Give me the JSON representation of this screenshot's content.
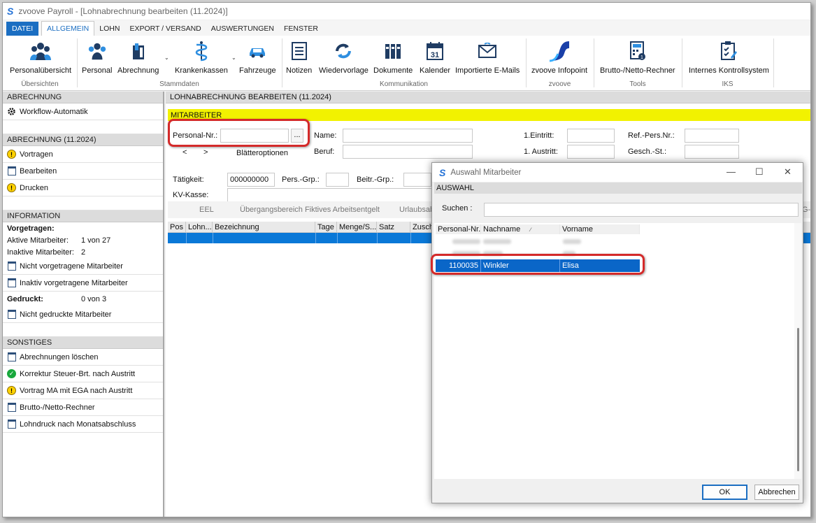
{
  "window": {
    "title": "zvoove Payroll - [Lohnabrechnung bearbeiten (11.2024)]"
  },
  "menu": {
    "datei": "DATEI",
    "tabs": [
      "ALLGEMEIN",
      "LOHN",
      "EXPORT / VERSAND",
      "AUSWERTUNGEN",
      "FENSTER"
    ]
  },
  "ribbon": {
    "buttons": [
      "Personalübersicht",
      "Personal",
      "Abrechnung",
      "Krankenkassen",
      "Fahrzeuge",
      "Notizen",
      "Wiedervorlage",
      "Dokumente",
      "Kalender",
      "Importierte E-Mails",
      "zvoove Infopoint",
      "Brutto-/Netto-Rechner",
      "Internes Kontrollsystem"
    ],
    "groups": [
      "Übersichten",
      "Stammdaten",
      "Kommunikation",
      "zvoove",
      "Tools",
      "IKS"
    ],
    "calendar_day": "31"
  },
  "sidebar": {
    "abrechnung_header": "ABRECHNUNG",
    "workflow": "Workflow-Automatik",
    "abrechnung_month_header": "ABRECHNUNG (11.2024)",
    "vortragen": "Vortragen",
    "bearbeiten": "Bearbeiten",
    "drucken": "Drucken",
    "information_header": "INFORMATION",
    "vorgetragen_label": "Vorgetragen:",
    "aktive_label": "Aktive Mitarbeiter:",
    "aktive_value": "1 von 27",
    "inaktive_label": "Inaktive Mitarbeiter:",
    "inaktive_value": "2",
    "nicht_vorgetragene": "Nicht vorgetragene Mitarbeiter",
    "inaktiv_vorgetragene": "Inaktiv vorgetragene Mitarbeiter",
    "gedruckt_label": "Gedruckt:",
    "gedruckt_value": "0 von 3",
    "nicht_gedruckte": "Nicht gedruckte Mitarbeiter",
    "sonstiges_header": "SONSTIGES",
    "sonstiges": [
      "Abrechnungen löschen",
      "Korrektur Steuer-Brt. nach Austritt",
      "Vortrag MA mit EGA nach Austritt",
      "Brutto-/Netto-Rechner",
      "Lohndruck nach Monatsabschluss"
    ]
  },
  "main": {
    "header": "LOHNABRECHNUNG BEARBEITEN (11.2024)",
    "section": "MITARBEITER",
    "personal_nr_label": "Personal-Nr.:",
    "browse_button": "...",
    "name_label": "Name:",
    "beruf_label": "Beruf:",
    "eintritt_label": "1.Eintritt:",
    "austritt_label": "1. Austritt:",
    "ref_pers_label": "Ref.-Pers.Nr.:",
    "gesch_st_label": "Gesch.-St.:",
    "nav_prev": "<",
    "nav_next": ">",
    "blaetteroptionen": "Blätteroptionen",
    "taetigkeit_label": "Tätigkeit:",
    "taetigkeit_value": "000000000",
    "pers_grp_label": "Pers.-Grp.:",
    "beitr_grp_label": "Beitr.-Grp.:",
    "kv_kasse_label": "KV-Kasse:",
    "subtabs": [
      "EEL",
      "Übergangsbereich Fiktives Arbeitsentgelt",
      "Urlaubsab"
    ],
    "subtab_right": "G-E",
    "grid_headers": [
      "Pos",
      "Lohn...",
      "Bezeichnung",
      "Tage",
      "Menge/S...",
      "Satz",
      "Zusch"
    ]
  },
  "dialog": {
    "title": "Auswahl Mitarbeiter",
    "section": "AUSWAHL",
    "search_label": "Suchen :",
    "search_value": "",
    "columns": [
      "Personal-Nr.",
      "Nachname",
      "Vorname"
    ],
    "selected_row": {
      "personal_nr": "1100035",
      "nachname": "Winkler",
      "vorname": "Elisa"
    },
    "ok": "OK",
    "cancel": "Abbrechen"
  },
  "colors": {
    "accent": "#1b6ec2",
    "highlight": "#f2f200",
    "selection": "#0a78d7",
    "annotation": "#d42a2a"
  }
}
